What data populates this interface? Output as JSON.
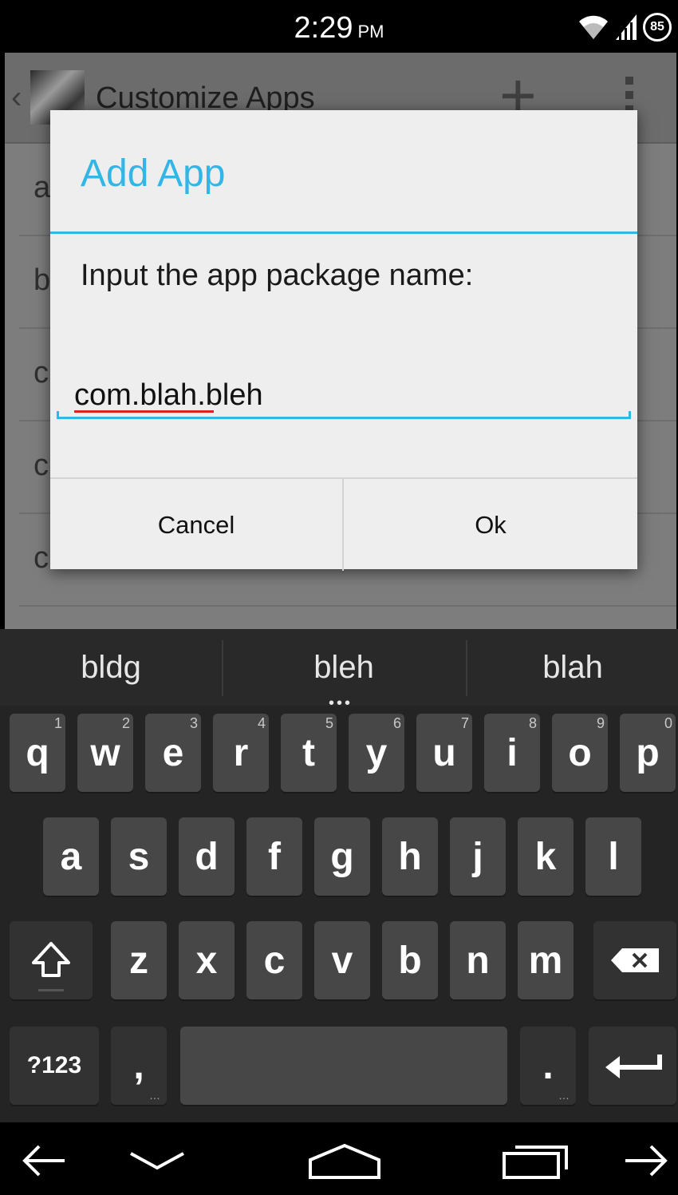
{
  "status_bar": {
    "time": "2:29",
    "ampm": "PM",
    "battery": "85"
  },
  "background_app": {
    "title": "Customize Apps",
    "rows": [
      "a",
      "b",
      "c",
      "c",
      "c"
    ]
  },
  "dialog": {
    "title": "Add App",
    "message": "Input the app package name:",
    "input_value": "com.blah.bleh",
    "cancel_label": "Cancel",
    "ok_label": "Ok"
  },
  "keyboard": {
    "suggestions": [
      "bldg",
      "bleh",
      "blah"
    ],
    "row1": [
      [
        "q",
        "1"
      ],
      [
        "w",
        "2"
      ],
      [
        "e",
        "3"
      ],
      [
        "r",
        "4"
      ],
      [
        "t",
        "5"
      ],
      [
        "y",
        "6"
      ],
      [
        "u",
        "7"
      ],
      [
        "i",
        "8"
      ],
      [
        "o",
        "9"
      ],
      [
        "p",
        "0"
      ]
    ],
    "row2": [
      "a",
      "s",
      "d",
      "f",
      "g",
      "h",
      "j",
      "k",
      "l"
    ],
    "row3": [
      "z",
      "x",
      "c",
      "v",
      "b",
      "n",
      "m"
    ],
    "symbols_label": "?123",
    "comma_label": ",",
    "period_label": ".",
    "shift_icon": "shift-icon",
    "delete_icon": "backspace-icon",
    "enter_icon": "enter-icon"
  },
  "nav_bar": {
    "icons": [
      "back-arrow-icon",
      "hide-keyboard-icon",
      "home-icon",
      "recents-icon",
      "forward-arrow-icon"
    ]
  },
  "colors": {
    "accent": "#33b5e5",
    "dialog_bg": "#eeeeee",
    "key_bg": "#474747",
    "keyboard_bg": "#242424"
  }
}
